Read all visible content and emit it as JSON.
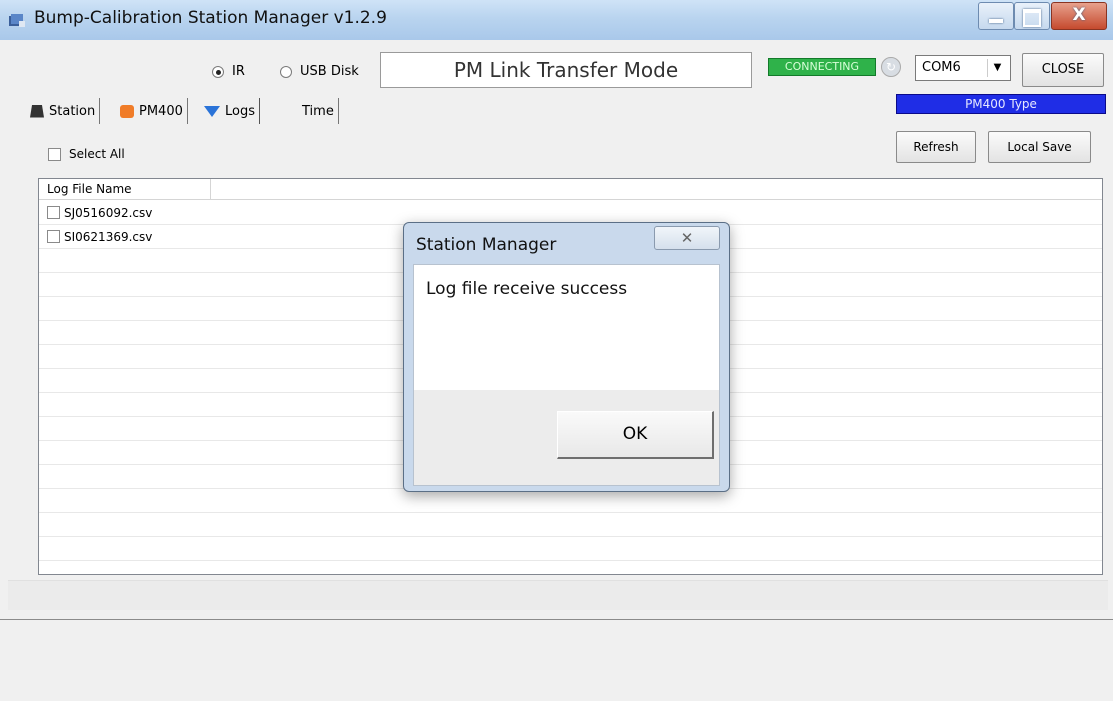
{
  "window": {
    "title": "Bump-Calibration Station Manager v1.2.9"
  },
  "transfer": {
    "radio_ir": "IR",
    "radio_usb": "USB Disk",
    "selected": "IR",
    "mode_text": "PM Link Transfer Mode"
  },
  "connection": {
    "status": "CONNECTING",
    "status_color": "#2fb24a",
    "port": "COM6",
    "close_label": "CLOSE",
    "device_type": "PM400 Type",
    "device_type_color": "#1f2de6"
  },
  "tabs": [
    {
      "label": "Station",
      "icon": "station-icon"
    },
    {
      "label": "PM400",
      "icon": "pm400-icon"
    },
    {
      "label": "Logs",
      "icon": "download-arrow-icon",
      "active": true
    },
    {
      "label": "Time"
    }
  ],
  "logs": {
    "select_all_label": "Select All",
    "refresh_label": "Refresh",
    "local_save_label": "Local Save",
    "column_header": "Log File Name",
    "files": [
      "SJ0516092.csv",
      "SI0621369.csv"
    ]
  },
  "dialog": {
    "title": "Station Manager",
    "message": "Log file receive success",
    "ok_label": "OK"
  }
}
